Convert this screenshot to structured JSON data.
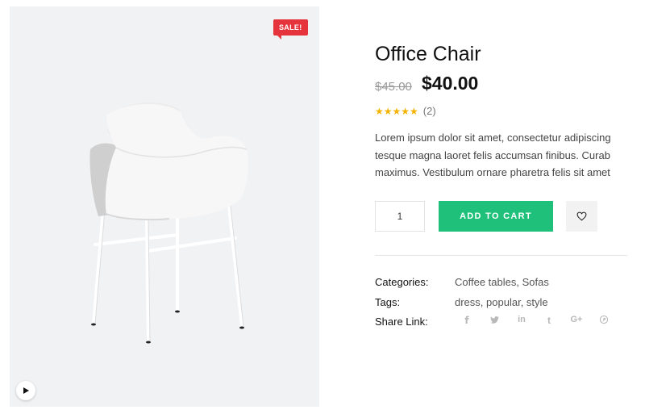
{
  "gallery": {
    "sale_badge": "SALE!",
    "image_alt": "white office chair",
    "play_icon": "play-icon"
  },
  "product": {
    "title": "Office Chair",
    "old_price": "$45.00",
    "price": "$40.00",
    "rating_value": 4.5,
    "rating_max": 5,
    "stars_display": "★★★★★",
    "review_count": "(2)",
    "description_lines": [
      "Lorem ipsum dolor sit amet, consectetur adipiscing",
      "tesque magna laoret felis accumsan finibus. Curab",
      "maximus. Vestibulum ornare pharetra felis sit amet"
    ]
  },
  "purchase": {
    "quantity": "1",
    "add_to_cart_label": "ADD TO CART",
    "wishlist_icon": "heart-icon"
  },
  "meta": {
    "categories_label": "Categories:",
    "categories": [
      "Coffee tables",
      "Sofas"
    ],
    "tags_label": "Tags:",
    "tags": [
      "dress",
      "popular",
      "style"
    ],
    "share_label": "Share Link:",
    "share_icons": [
      "facebook-icon",
      "twitter-icon",
      "linkedin-icon",
      "tumblr-icon",
      "google-plus-icon",
      "pinterest-icon"
    ]
  },
  "colors": {
    "sale": "#e5343b",
    "accent": "#1fc17a",
    "star": "#f5b301",
    "gallery_bg": "#f1f2f4"
  }
}
